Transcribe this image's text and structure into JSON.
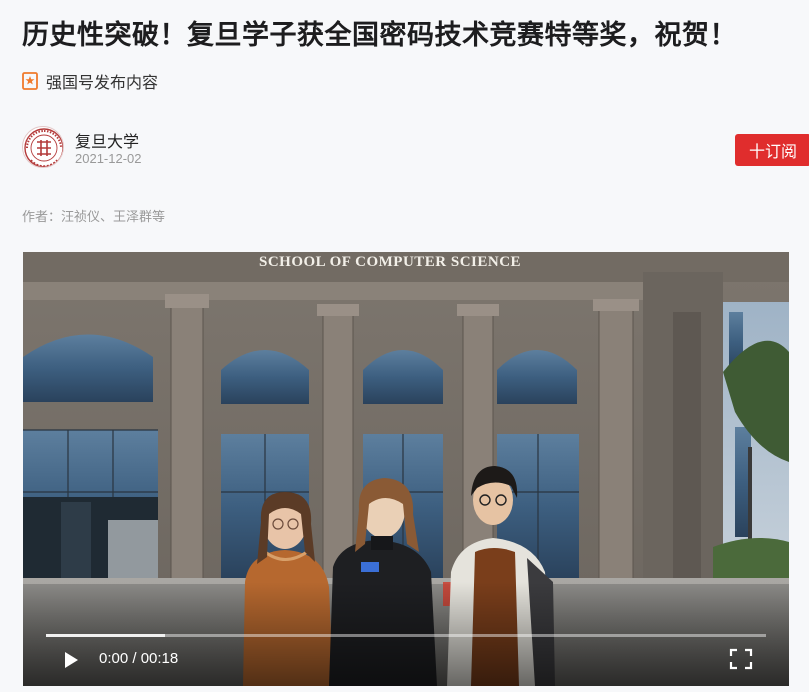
{
  "article": {
    "title": "历史性突破！复旦学子获全国密码技术竞赛特等奖，祝贺！",
    "source_label": "强国号发布内容",
    "publisher": "复旦大学",
    "date": "2021-12-02",
    "byline": "作者：汪祯仪、王泽群等",
    "subscribe_label": "十订阅"
  },
  "video": {
    "sign_text": "SCHOOL OF COMPUTER SCIENCE",
    "current_time": "0:00",
    "duration": "00:18",
    "time_display": "0:00 / 00:18",
    "progress_fraction": 0
  },
  "colors": {
    "accent": "#e02d2d",
    "source_icon": "#f07a2c"
  },
  "icons": {
    "source": "bookmark-flag-icon",
    "play": "play-icon",
    "fullscreen": "fullscreen-icon"
  }
}
